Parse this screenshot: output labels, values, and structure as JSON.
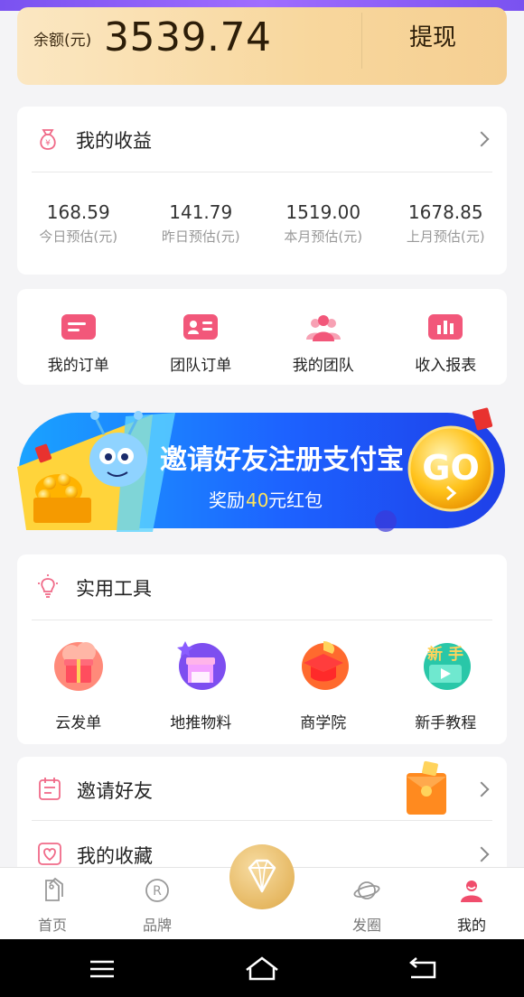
{
  "balance": {
    "label": "余额(元)",
    "value": "3539.74",
    "withdraw_label": "提现"
  },
  "earnings": {
    "title": "我的收益",
    "stats": [
      {
        "value": "168.59",
        "label": "今日预估(元)"
      },
      {
        "value": "141.79",
        "label": "昨日预估(元)"
      },
      {
        "value": "1519.00",
        "label": "本月预估(元)"
      },
      {
        "value": "1678.85",
        "label": "上月预估(元)"
      }
    ]
  },
  "orders": [
    {
      "label": "我的订单",
      "icon": "order-list-icon"
    },
    {
      "label": "团队订单",
      "icon": "team-order-icon"
    },
    {
      "label": "我的团队",
      "icon": "team-icon"
    },
    {
      "label": "收入报表",
      "icon": "report-chart-icon"
    }
  ],
  "banner": {
    "title": "邀请好友注册支付宝",
    "subtitle_prefix": "奖励",
    "subtitle_amount": "40",
    "subtitle_suffix": "元红包",
    "go": "GO"
  },
  "tools": {
    "title": "实用工具",
    "items": [
      {
        "label": "云发单",
        "icon": "gift-cloud-icon"
      },
      {
        "label": "地推物料",
        "icon": "shop-stall-icon"
      },
      {
        "label": "商学院",
        "icon": "graduation-cap-icon"
      },
      {
        "label": "新手教程",
        "icon": "video-tutorial-icon"
      }
    ],
    "badge_text": "新 手"
  },
  "list": [
    {
      "label": "邀请好友",
      "icon": "invite-calendar-icon"
    },
    {
      "label": "我的收藏",
      "icon": "heart-icon"
    }
  ],
  "tabs": [
    {
      "label": "首页",
      "icon": "tags-icon"
    },
    {
      "label": "品牌",
      "icon": "registered-icon"
    },
    {
      "label": "",
      "icon": "diamond-icon"
    },
    {
      "label": "发圈",
      "icon": "planet-icon"
    },
    {
      "label": "我的",
      "icon": "profile-icon"
    }
  ],
  "colors": {
    "accent": "#f04d6c",
    "gold": "#e6b862",
    "banner_blue": "#1d62ff"
  }
}
